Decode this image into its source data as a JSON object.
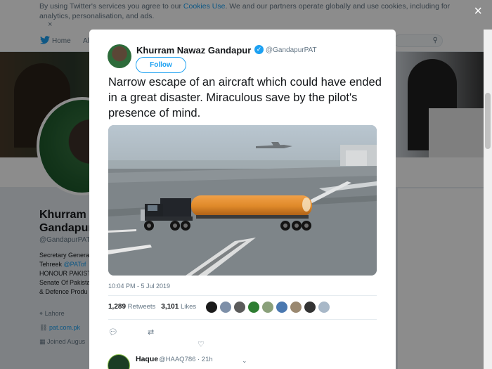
{
  "cookie_banner": {
    "text_before": "By using Twitter's services you agree to our ",
    "link": "Cookies Use",
    "text_after": ". We and our partners operate globally and use cookies, including for analytics, personalisation, and ads.",
    "dismiss": "×"
  },
  "close_label": "×",
  "nav": {
    "home_label": "Home",
    "other_label": "Al"
  },
  "profile": {
    "name_line1": "Khurram N",
    "name_line2": "Gandapur",
    "handle": "@GandapurPAT",
    "bio": [
      "Secretary Genera",
      "Tehreek @PATof",
      "HONOUR PAKIST",
      "Senate Of Pakista",
      "& Defence Produ"
    ],
    "bio_link": "@PATof",
    "location": "Lahore",
    "website": "pat.com.pk",
    "joined": "Joined Augus"
  },
  "tweet": {
    "author_name": "Khurram Nawaz Gandapur",
    "verified_glyph": "✓",
    "author_handle": "@GandapurPAT",
    "follow_label": "Follow",
    "text": "Narrow escape of an aircraft which could have ended in a great disaster. Miraculous save by the pilot's presence of mind.",
    "timestamp": "10:04 PM - 5 Jul 2019",
    "retweets_count": "1,289",
    "retweets_label": "Retweets",
    "likes_count": "3,101",
    "likes_label": "Likes",
    "liker_colors": [
      "#1b1b1b",
      "#7d8fa8",
      "#5b5b5b",
      "#2e7d32",
      "#8aa07a",
      "#4a78b0",
      "#9a8870",
      "#333333",
      "#a8b8c8"
    ]
  },
  "reply": {
    "name": "Haque",
    "handle": "@HAAQ786",
    "time": "· 21h",
    "chevron": "⌄"
  },
  "colors": {
    "accent": "#1da1f2",
    "tanker": "#e08a2a"
  }
}
